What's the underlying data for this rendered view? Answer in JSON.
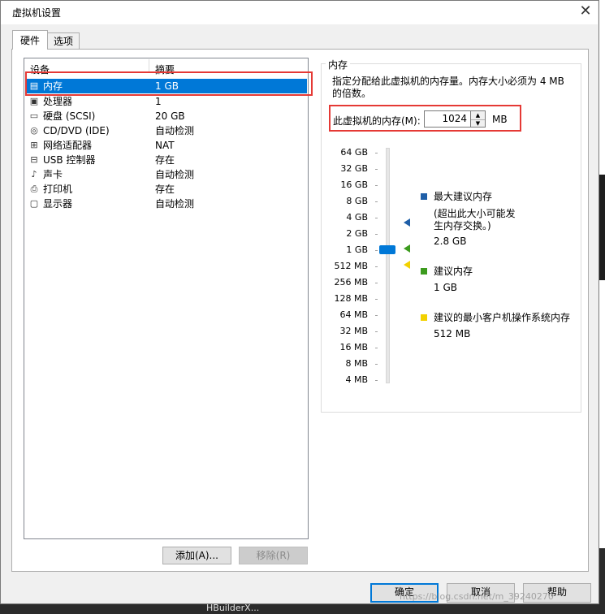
{
  "window": {
    "title": "虚拟机设置",
    "close_glyph": "✕"
  },
  "tabs": [
    {
      "label": "硬件"
    },
    {
      "label": "选项"
    }
  ],
  "device_table": {
    "columns": [
      "设备",
      "摘要"
    ],
    "rows": [
      {
        "icon": "memory-icon",
        "name": "内存",
        "summary": "1 GB",
        "selected": true
      },
      {
        "icon": "cpu-icon",
        "name": "处理器",
        "summary": "1"
      },
      {
        "icon": "hard-disk-icon",
        "name": "硬盘 (SCSI)",
        "summary": "20 GB"
      },
      {
        "icon": "cd-dvd-icon",
        "name": "CD/DVD (IDE)",
        "summary": "自动检测"
      },
      {
        "icon": "network-adapter-icon",
        "name": "网络适配器",
        "summary": "NAT"
      },
      {
        "icon": "usb-icon",
        "name": "USB 控制器",
        "summary": "存在"
      },
      {
        "icon": "sound-card-icon",
        "name": "声卡",
        "summary": "自动检测"
      },
      {
        "icon": "printer-icon",
        "name": "打印机",
        "summary": "存在"
      },
      {
        "icon": "display-icon",
        "name": "显示器",
        "summary": "自动检测"
      }
    ]
  },
  "device_buttons": {
    "add": "添加(A)...",
    "remove": "移除(R)"
  },
  "memory": {
    "group_title": "内存",
    "description": "指定分配给此虚拟机的内存量。内存大小必须为 4 MB 的倍数。",
    "field_label": "此虚拟机的内存(M):",
    "value": "1024",
    "unit": "MB",
    "scale": [
      "64 GB",
      "32 GB",
      "16 GB",
      "8 GB",
      "4 GB",
      "2 GB",
      "1 GB",
      "512 MB",
      "256 MB",
      "128 MB",
      "64 MB",
      "32 MB",
      "16 MB",
      "8 MB",
      "4 MB"
    ],
    "slider_value": "1 GB",
    "legend": {
      "max": {
        "label": "最大建议内存",
        "note": "(超出此大小可能发生内存交换。)",
        "value": "2.8 GB",
        "color": "#1f5fa8"
      },
      "recommended": {
        "label": "建议内存",
        "value": "1 GB",
        "color": "#3c9b1e"
      },
      "min": {
        "label": "建议的最小客户机操作系统内存",
        "value": "512 MB",
        "color": "#f2d100"
      }
    }
  },
  "footer_buttons": {
    "ok": "确定",
    "cancel": "取消",
    "help": "帮助"
  },
  "watermark": "https://blog.csdn.net/m_39240270",
  "taskbar_text": "HBuilderX..."
}
